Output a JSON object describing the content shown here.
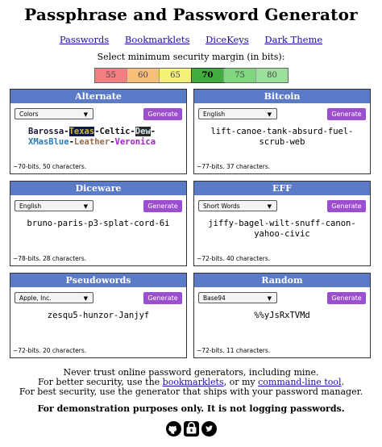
{
  "title": "Passphrase and Password Generator",
  "nav": [
    "Passwords",
    "Bookmarklets",
    "DiceKeys",
    "Dark Theme"
  ],
  "margin_prompt": "Select minimum security margin (in bits):",
  "margins": [
    {
      "label": "55",
      "color": "#f08080"
    },
    {
      "label": "60",
      "color": "#f7c07a"
    },
    {
      "label": "65",
      "color": "#f5f07a"
    },
    {
      "label": "70",
      "color": "#3fae3f"
    },
    {
      "label": "75",
      "color": "#7fd67f"
    },
    {
      "label": "80",
      "color": "#9be09b"
    }
  ],
  "selected_margin": "70",
  "cards": {
    "alternate": {
      "title": "Alternate",
      "select": "Colors",
      "button": "Generate",
      "words": [
        {
          "t": "Barossa",
          "c": "#1a1a3a"
        },
        {
          "t": "-",
          "c": "#000"
        },
        {
          "t": "Texas",
          "c": "#cdb84b",
          "bg": "#0b1a4a"
        },
        {
          "t": "-",
          "c": "#000"
        },
        {
          "t": "Celtic",
          "c": "#111111"
        },
        {
          "t": "-",
          "c": "#000"
        },
        {
          "t": "Dew",
          "c": "#d8e7f0",
          "bg": "#2a2a2a"
        },
        {
          "t": "-",
          "c": "#000"
        },
        {
          "t": "XMasBlue",
          "c": "#2a7ab8"
        },
        {
          "t": "-",
          "c": "#000"
        },
        {
          "t": "Leather",
          "c": "#9b6a45"
        },
        {
          "t": "-",
          "c": "#000"
        },
        {
          "t": "Veronica",
          "c": "#a020c8"
        }
      ],
      "meta": "~70-bits. 50 characters."
    },
    "bitcoin": {
      "title": "Bitcoin",
      "select": "English",
      "button": "Generate",
      "password": "lift-canoe-tank-absurd-fuel-scrub-web",
      "meta": "~77-bits. 37 characters."
    },
    "diceware": {
      "title": "Diceware",
      "select": "English",
      "button": "Generate",
      "password": "bruno-paris-p3-splat-cord-6i",
      "meta": "~78-bits. 28 characters."
    },
    "eff": {
      "title": "EFF",
      "select": "Short Words",
      "button": "Generate",
      "password": "jiffy-bagel-wilt-snuff-canon-yahoo-civic",
      "meta": "~72-bits. 40 characters."
    },
    "pseudowords": {
      "title": "Pseudowords",
      "select": "Apple, Inc.",
      "button": "Generate",
      "password": "zesqu5-hunzor-Janjyf",
      "meta": "~72-bits. 20 characters."
    },
    "random": {
      "title": "Random",
      "select": "Base94",
      "button": "Generate",
      "password": "%%yJsRxTVMd",
      "meta": "~72-bits. 11 characters."
    }
  },
  "footer": {
    "line1": "Never trust online password generators, including mine.",
    "line2_pre": "For better security, use the ",
    "line2_link1": "bookmarklets",
    "line2_mid": ", or my ",
    "line2_link2": "command-line tool",
    "line2_post": ".",
    "line3": "For best security, use the generator that ships with your password manager."
  },
  "demo": "For demonstration purposes only. It is not logging passwords.",
  "icons": [
    "github-icon",
    "keybase-icon",
    "twitter-icon"
  ]
}
